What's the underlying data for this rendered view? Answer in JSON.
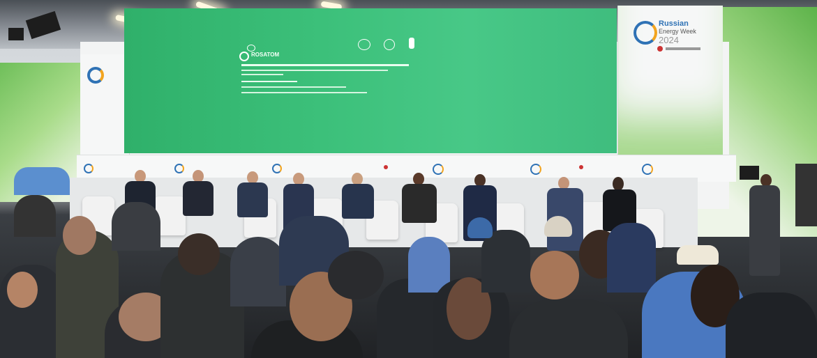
{
  "scene": {
    "screen": {
      "brand_line": "ROSATOM"
    },
    "backdrop": {
      "event_name_line1": "Russian",
      "event_name_line2": "Energy Week",
      "event_year": "2024"
    }
  },
  "colors": {
    "screen_green": "#3cc07a",
    "wall_green": "#6fbf5a",
    "logo_blue": "#2f72b5",
    "logo_orange": "#f2a41f"
  }
}
